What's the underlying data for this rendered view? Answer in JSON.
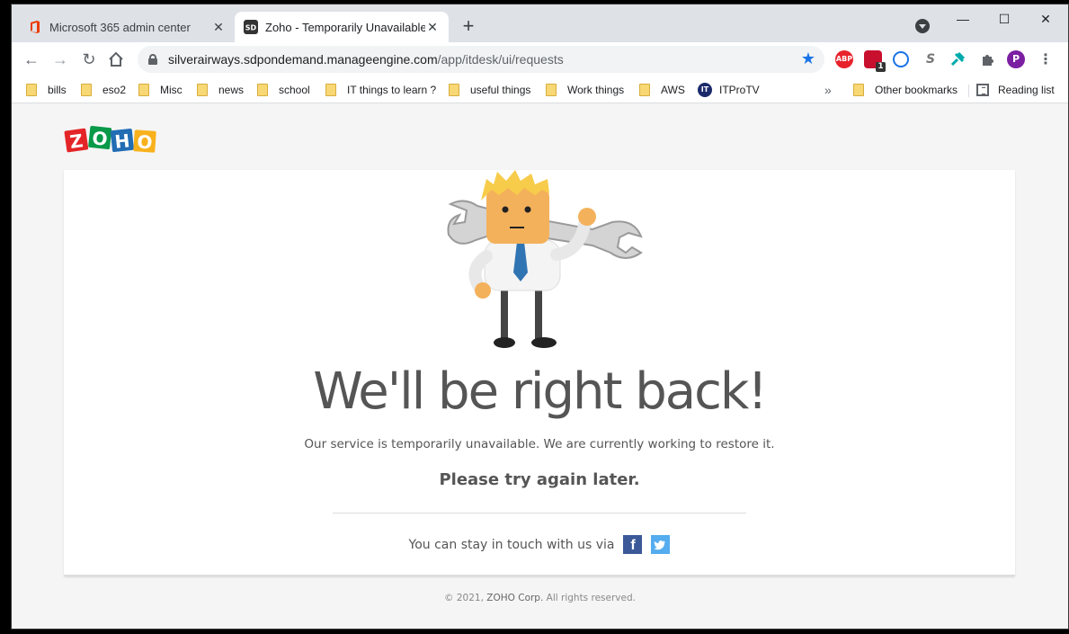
{
  "browser": {
    "tabs": [
      {
        "label": "Microsoft 365 admin center",
        "active": false
      },
      {
        "label": "Zoho - Temporarily Unavailable",
        "active": true
      }
    ],
    "favicon_text": "SD",
    "url_host": "silverairways.sdpondemand.manageengine.com",
    "url_path": "/app/itdesk/ui/requests",
    "ext_abp": "ABP",
    "ext_badge": "1",
    "profile_initial": "P",
    "overflow_chevron": "»"
  },
  "bookmarks": [
    "bills",
    "eso2",
    "Misc",
    "news",
    "school",
    "IT things to learn ?",
    "useful things",
    "Work things",
    "AWS",
    "ITProTV"
  ],
  "bookmarks_right": {
    "other": "Other bookmarks",
    "reading": "Reading list"
  },
  "itp_icon_text": "IT",
  "page": {
    "logo_letters": [
      "Z",
      "O",
      "H",
      "O"
    ],
    "headline": "We'll be right back!",
    "subtext": "Our service is temporarily unavailable. We are currently working to restore it.",
    "try_again": "Please try again later.",
    "social_text": "You can stay in touch with us via",
    "fb_glyph": "f",
    "footer_prefix": "© 2021,",
    "footer_brand": "ZOHO Corp.",
    "footer_suffix": "All rights reserved."
  },
  "colors": {
    "logo": [
      "#e42527",
      "#089949",
      "#226db4",
      "#f9b21d"
    ],
    "facebook": "#3b5998",
    "twitter": "#55acee",
    "accent": "#1a73e8"
  }
}
